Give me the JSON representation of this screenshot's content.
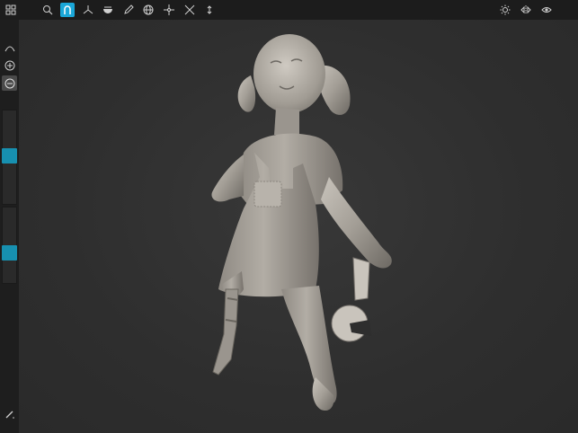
{
  "toolbar": {
    "left": [
      {
        "name": "menu-grid-icon",
        "active": false
      },
      {
        "name": "search-icon",
        "active": false
      },
      {
        "name": "magnet-icon",
        "active": true
      },
      {
        "name": "axis-icon",
        "active": false
      },
      {
        "name": "bowl-icon",
        "active": false
      },
      {
        "name": "pencil-icon",
        "active": false
      },
      {
        "name": "globe-icon",
        "active": false
      },
      {
        "name": "move-icon",
        "active": false
      },
      {
        "name": "scale-icon",
        "active": false
      },
      {
        "name": "updown-icon",
        "active": false
      }
    ],
    "right": [
      {
        "name": "sun-icon"
      },
      {
        "name": "symmetry-icon"
      },
      {
        "name": "eye-icon"
      }
    ]
  },
  "sidebar": {
    "curve_button": "curve-icon",
    "add_button": "plus-circle-icon",
    "subtract_button": "minus-circle-icon",
    "radius_slider": {
      "value": 0.52
    },
    "intensity_slider": {
      "value": 0.38
    },
    "bottom_button": "brush-icon"
  },
  "colors": {
    "accent": "#1aa7d8",
    "slider_thumb": "#1790b0",
    "sculpt": "#a8a39c",
    "background": "#2f2f2f"
  }
}
